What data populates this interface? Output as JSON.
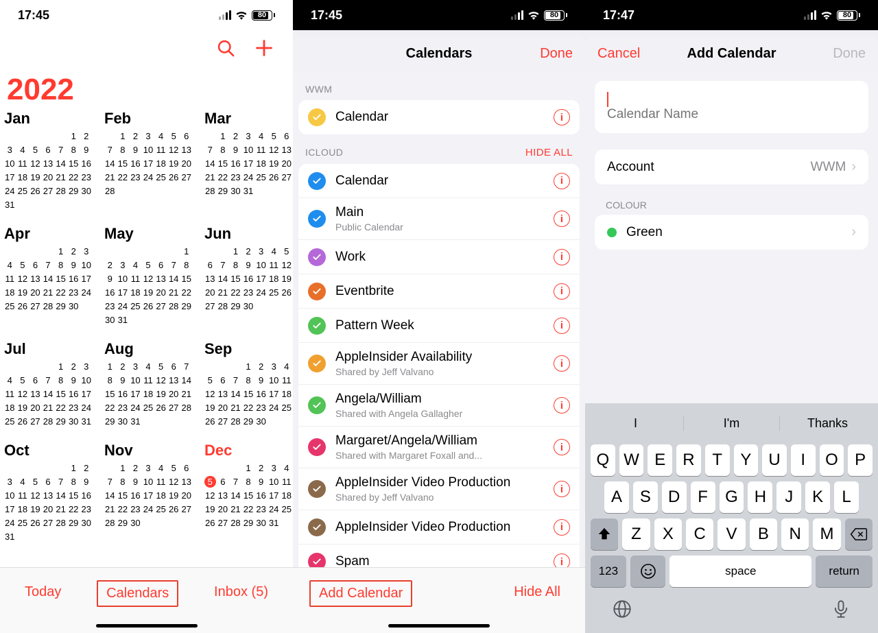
{
  "status": {
    "time1": "17:45",
    "time2": "17:45",
    "time3": "17:47",
    "battery_pct": 80
  },
  "pane1": {
    "year": "2022",
    "today_day": 5,
    "months": [
      {
        "name": "Jan",
        "start": 5,
        "days": 31
      },
      {
        "name": "Feb",
        "start": 1,
        "days": 28
      },
      {
        "name": "Mar",
        "start": 1,
        "days": 31
      },
      {
        "name": "Apr",
        "start": 4,
        "days": 30
      },
      {
        "name": "May",
        "start": 6,
        "days": 31
      },
      {
        "name": "Jun",
        "start": 2,
        "days": 30
      },
      {
        "name": "Jul",
        "start": 4,
        "days": 31
      },
      {
        "name": "Aug",
        "start": 0,
        "days": 31
      },
      {
        "name": "Sep",
        "start": 3,
        "days": 30
      },
      {
        "name": "Oct",
        "start": 5,
        "days": 31
      },
      {
        "name": "Nov",
        "start": 1,
        "days": 30
      },
      {
        "name": "Dec",
        "start": 3,
        "days": 31,
        "current": true
      }
    ],
    "toolbar": {
      "today": "Today",
      "calendars": "Calendars",
      "inbox": "Inbox (5)"
    }
  },
  "pane2": {
    "title": "Calendars",
    "done": "Done",
    "sections": [
      {
        "header": "WWM",
        "hide": null,
        "items": [
          {
            "title": "Calendar",
            "color": "#f7c844"
          }
        ]
      },
      {
        "header": "ICLOUD",
        "hide": "HIDE ALL",
        "items": [
          {
            "title": "Calendar",
            "color": "#1f8ded"
          },
          {
            "title": "Main",
            "sub": "Public Calendar",
            "color": "#1f8ded"
          },
          {
            "title": "Work",
            "color": "#b569d8"
          },
          {
            "title": "Eventbrite",
            "color": "#e86f2a"
          },
          {
            "title": "Pattern Week",
            "color": "#52c356"
          },
          {
            "title": "AppleInsider Availability",
            "sub": "Shared by Jeff Valvano",
            "color": "#f0a030"
          },
          {
            "title": "Angela/William",
            "sub": "Shared with Angela Gallagher",
            "color": "#52c356"
          },
          {
            "title": "Margaret/Angela/William",
            "sub": "Shared with Margaret Foxall and...",
            "color": "#e6356b"
          },
          {
            "title": "AppleInsider Video Production",
            "sub": "Shared by Jeff Valvano",
            "color": "#8a6a4a"
          },
          {
            "title": "AppleInsider Video Production",
            "color": "#8a6a4a"
          },
          {
            "title": "Spam",
            "color": "#e6356b"
          }
        ]
      }
    ],
    "toolbar": {
      "add": "Add Calendar",
      "hideall": "Hide All"
    }
  },
  "pane3": {
    "cancel": "Cancel",
    "title": "Add Calendar",
    "done": "Done",
    "name_placeholder": "Calendar Name",
    "account_label": "Account",
    "account_value": "WWM",
    "colour_header": "COLOUR",
    "colour_name": "Green",
    "colour_hex": "#34c759",
    "suggestions": [
      "I",
      "I'm",
      "Thanks"
    ],
    "keys_r1": [
      "Q",
      "W",
      "E",
      "R",
      "T",
      "Y",
      "U",
      "I",
      "O",
      "P"
    ],
    "keys_r2": [
      "A",
      "S",
      "D",
      "F",
      "G",
      "H",
      "J",
      "K",
      "L"
    ],
    "keys_r3": [
      "Z",
      "X",
      "C",
      "V",
      "B",
      "N",
      "M"
    ],
    "k123": "123",
    "kspace": "space",
    "kreturn": "return"
  }
}
